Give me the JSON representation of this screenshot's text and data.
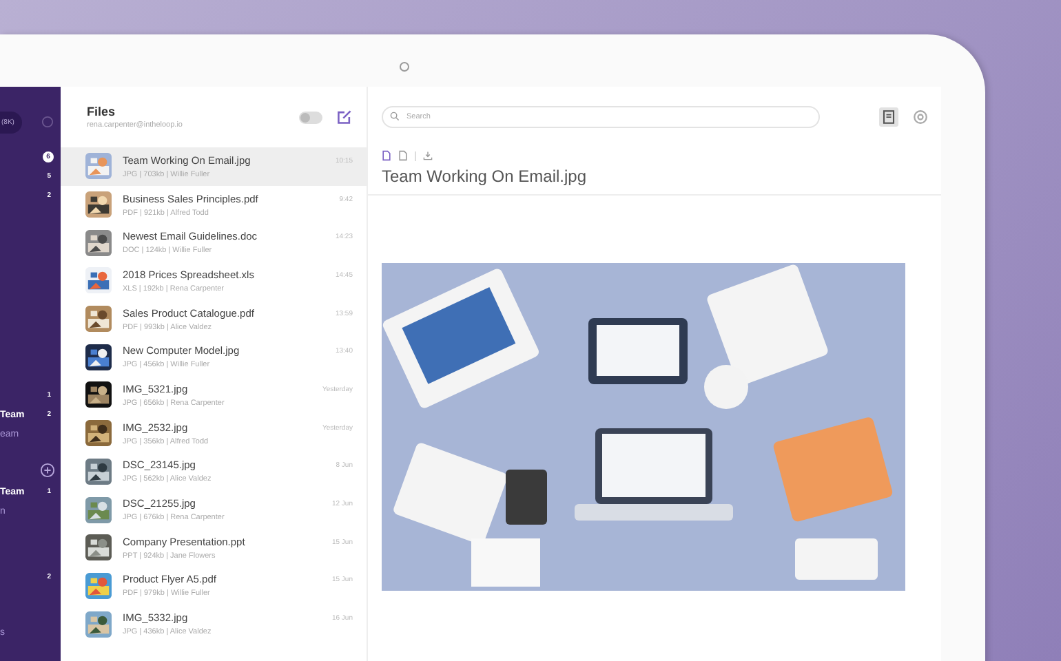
{
  "sidebar": {
    "storage_pill": "(8K)",
    "items": [
      {
        "count": "6",
        "kind": "badge"
      },
      {
        "count": "5",
        "kind": "count"
      },
      {
        "count": "2",
        "kind": "count"
      },
      {
        "count": "1",
        "kind": "count"
      },
      {
        "label": "Team",
        "count": "2",
        "kind": "team"
      },
      {
        "label": "eam",
        "kind": "sub"
      },
      {
        "label": "Team",
        "count": "1",
        "kind": "team"
      },
      {
        "label": "n",
        "kind": "sub"
      },
      {
        "count": "2",
        "kind": "count"
      },
      {
        "label": "s",
        "kind": "sub"
      }
    ]
  },
  "files": {
    "title": "Files",
    "email": "rena.carpenter@intheloop.io",
    "toggle_on": false,
    "items": [
      {
        "name": "Team Working On Email.jpg",
        "meta": "JPG | 703kb | Willie Fuller",
        "time": "10:15",
        "selected": true
      },
      {
        "name": "Business Sales Principles.pdf",
        "meta": "PDF | 921kb | Alfred Todd",
        "time": "9:42",
        "selected": false
      },
      {
        "name": "Newest Email Guidelines.doc",
        "meta": "DOC | 124kb | Willie Fuller",
        "time": "14:23",
        "selected": false
      },
      {
        "name": "2018 Prices Spreadsheet.xls",
        "meta": "XLS | 192kb | Rena Carpenter",
        "time": "14:45",
        "selected": false
      },
      {
        "name": "Sales Product Catalogue.pdf",
        "meta": "PDF | 993kb | Alice Valdez",
        "time": "13:59",
        "selected": false
      },
      {
        "name": "New Computer Model.jpg",
        "meta": "JPG | 456kb | Willie Fuller",
        "time": "13:40",
        "selected": false
      },
      {
        "name": "IMG_5321.jpg",
        "meta": "JPG | 656kb | Rena Carpenter",
        "time": "Yesterday",
        "selected": false
      },
      {
        "name": "IMG_2532.jpg",
        "meta": "JPG | 356kb | Alfred Todd",
        "time": "Yesterday",
        "selected": false
      },
      {
        "name": "DSC_23145.jpg",
        "meta": "JPG | 562kb | Alice Valdez",
        "time": "8 Jun",
        "selected": false
      },
      {
        "name": "DSC_21255.jpg",
        "meta": "JPG | 676kb | Rena Carpenter",
        "time": "12 Jun",
        "selected": false
      },
      {
        "name": "Company Presentation.ppt",
        "meta": "PPT | 924kb | Jane Flowers",
        "time": "15 Jun",
        "selected": false
      },
      {
        "name": "Product Flyer A5.pdf",
        "meta": "PDF | 979kb | Willie Fuller",
        "time": "15 Jun",
        "selected": false
      },
      {
        "name": "IMG_5332.jpg",
        "meta": "JPG | 436kb | Alice Valdez",
        "time": "16 Jun",
        "selected": false
      }
    ]
  },
  "search": {
    "placeholder": "Search"
  },
  "preview": {
    "title": "Team Working On Email.jpg"
  }
}
